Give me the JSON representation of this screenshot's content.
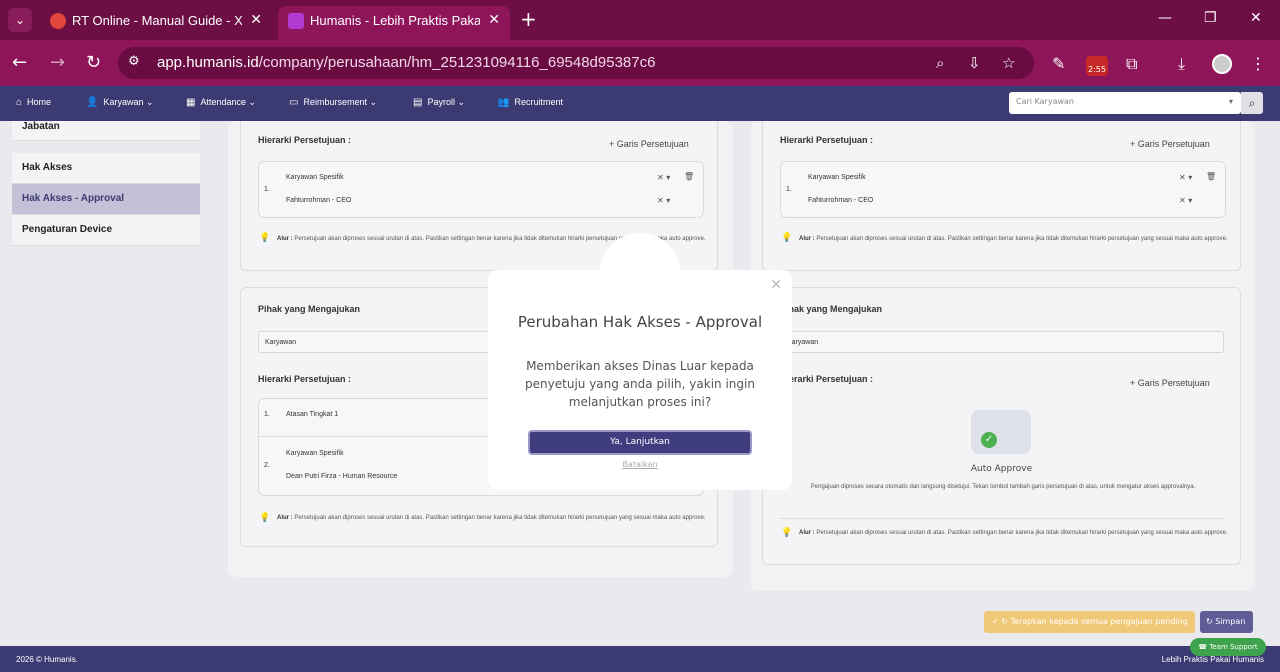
{
  "browser": {
    "tabs": [
      {
        "title": "RT Online - Manual Guide - Xm",
        "close": "✕"
      },
      {
        "title": "Humanis - Lebih Praktis Pakai H",
        "close": "✕"
      }
    ],
    "url_host": "app.humanis.id",
    "url_path": "/company/perusahaan/hm_251231094116_69548d95387c6",
    "timer_badge": "2:55"
  },
  "appnav": {
    "items": [
      {
        "label": "Home",
        "icon": "home-icon"
      },
      {
        "label": "Karyawan",
        "icon": "user-icon"
      },
      {
        "label": "Attendance",
        "icon": "calendar-icon"
      },
      {
        "label": "Reimbursement",
        "icon": "money-icon"
      },
      {
        "label": "Payroll",
        "icon": "payroll-icon"
      },
      {
        "label": "Recruitment",
        "icon": "group-icon"
      }
    ],
    "search_placeholder": "Cari Karyawan"
  },
  "sidebar": {
    "items": [
      "Jabatan",
      "Hak Akses",
      "Hak Akses - Approval",
      "Pengaturan Device"
    ],
    "active_index": 2
  },
  "left_panel": {
    "hierarki_label": "Hierarki Persetujuan :",
    "garis_label": "Garis Persetujuan",
    "top_row_num": "1.",
    "top_row_type": "Karyawan Spesifik",
    "top_row_person": "Fahturrohman - CEO",
    "alur_prefix": "Alur :",
    "alur_text": "Persetujuan akan diproses sesuai urutan di atas. Pastikan settingan benar karena jika tidak ditemukan hirarki persetujuan yang sesuai maka auto approve.",
    "pihak_label": "Pihak yang Mengajukan",
    "pihak_value": "Karyawan",
    "hierarki2_label": "Hierarki Persetujuan :",
    "row1_num": "1.",
    "row1_text": "Atasan Tingkat 1",
    "row2_num": "2.",
    "row2_type": "Karyawan Spesifik",
    "row2_person": "Dean Putri Firza - Human Resource",
    "alur2_prefix": "Alur :",
    "alur2_text": "Persetujuan akan diproses sesuai urutan di atas. Pastikan settingan benar karena jika tidak ditemukan hirarki persetujuan yang sesuai maka auto approve."
  },
  "right_panel": {
    "hierarki_label": "Hierarki Persetujuan :",
    "garis_label": "Garis Persetujuan",
    "top_row_num": "1.",
    "top_row_type": "Karyawan Spesifik",
    "top_row_person": "Fahturrohman - CEO",
    "alur_prefix": "Alur :",
    "alur_text": "Persetujuan akan diproses sesuai urutan di atas. Pastikan settingan benar karena jika tidak ditemukan hirarki persetujuan yang sesuai maka auto approve.",
    "pihak_label": "Pihak yang Mengajukan",
    "pihak_value": "Karyawan",
    "hierarki2_label": "Hierarki Persetujuan :",
    "garis2_label": "Garis Persetujuan",
    "auto_approve_title": "Auto Approve",
    "auto_approve_desc": "Pengajuan diproses secara otomatis dan langsung disetujui. Tekan tombol tambah garis persetujuan di atas, untuk mengatur akses approvalnya.",
    "alur2_prefix": "Alur :",
    "alur2_text": "Persetujuan akan diproses sesuai urutan di atas. Pastikan settingan benar karena jika tidak ditemukan hirarki persetujuan yang sesuai maka auto approve."
  },
  "actions": {
    "terapkan_label": "Terapkan kepada semua pengajuan pending",
    "simpan_label": "Simpan",
    "team_support": "Team Support"
  },
  "footer": {
    "left": "2026 © Humanis.",
    "right": "Lebih Praktis Pakai Humanis"
  },
  "modal": {
    "title": "Perubahan Hak Akses - Approval",
    "message": "Memberikan akses Dinas Luar kepada penyetuju yang anda pilih, yakin ingin melanjutkan proses ini?",
    "confirm_label": "Ya, Lanjutkan",
    "cancel_label": "Batalkan"
  },
  "colors": {
    "browser": "#8e155a",
    "appnav": "#3c3a72",
    "primary_button": "#3f3d7e"
  }
}
